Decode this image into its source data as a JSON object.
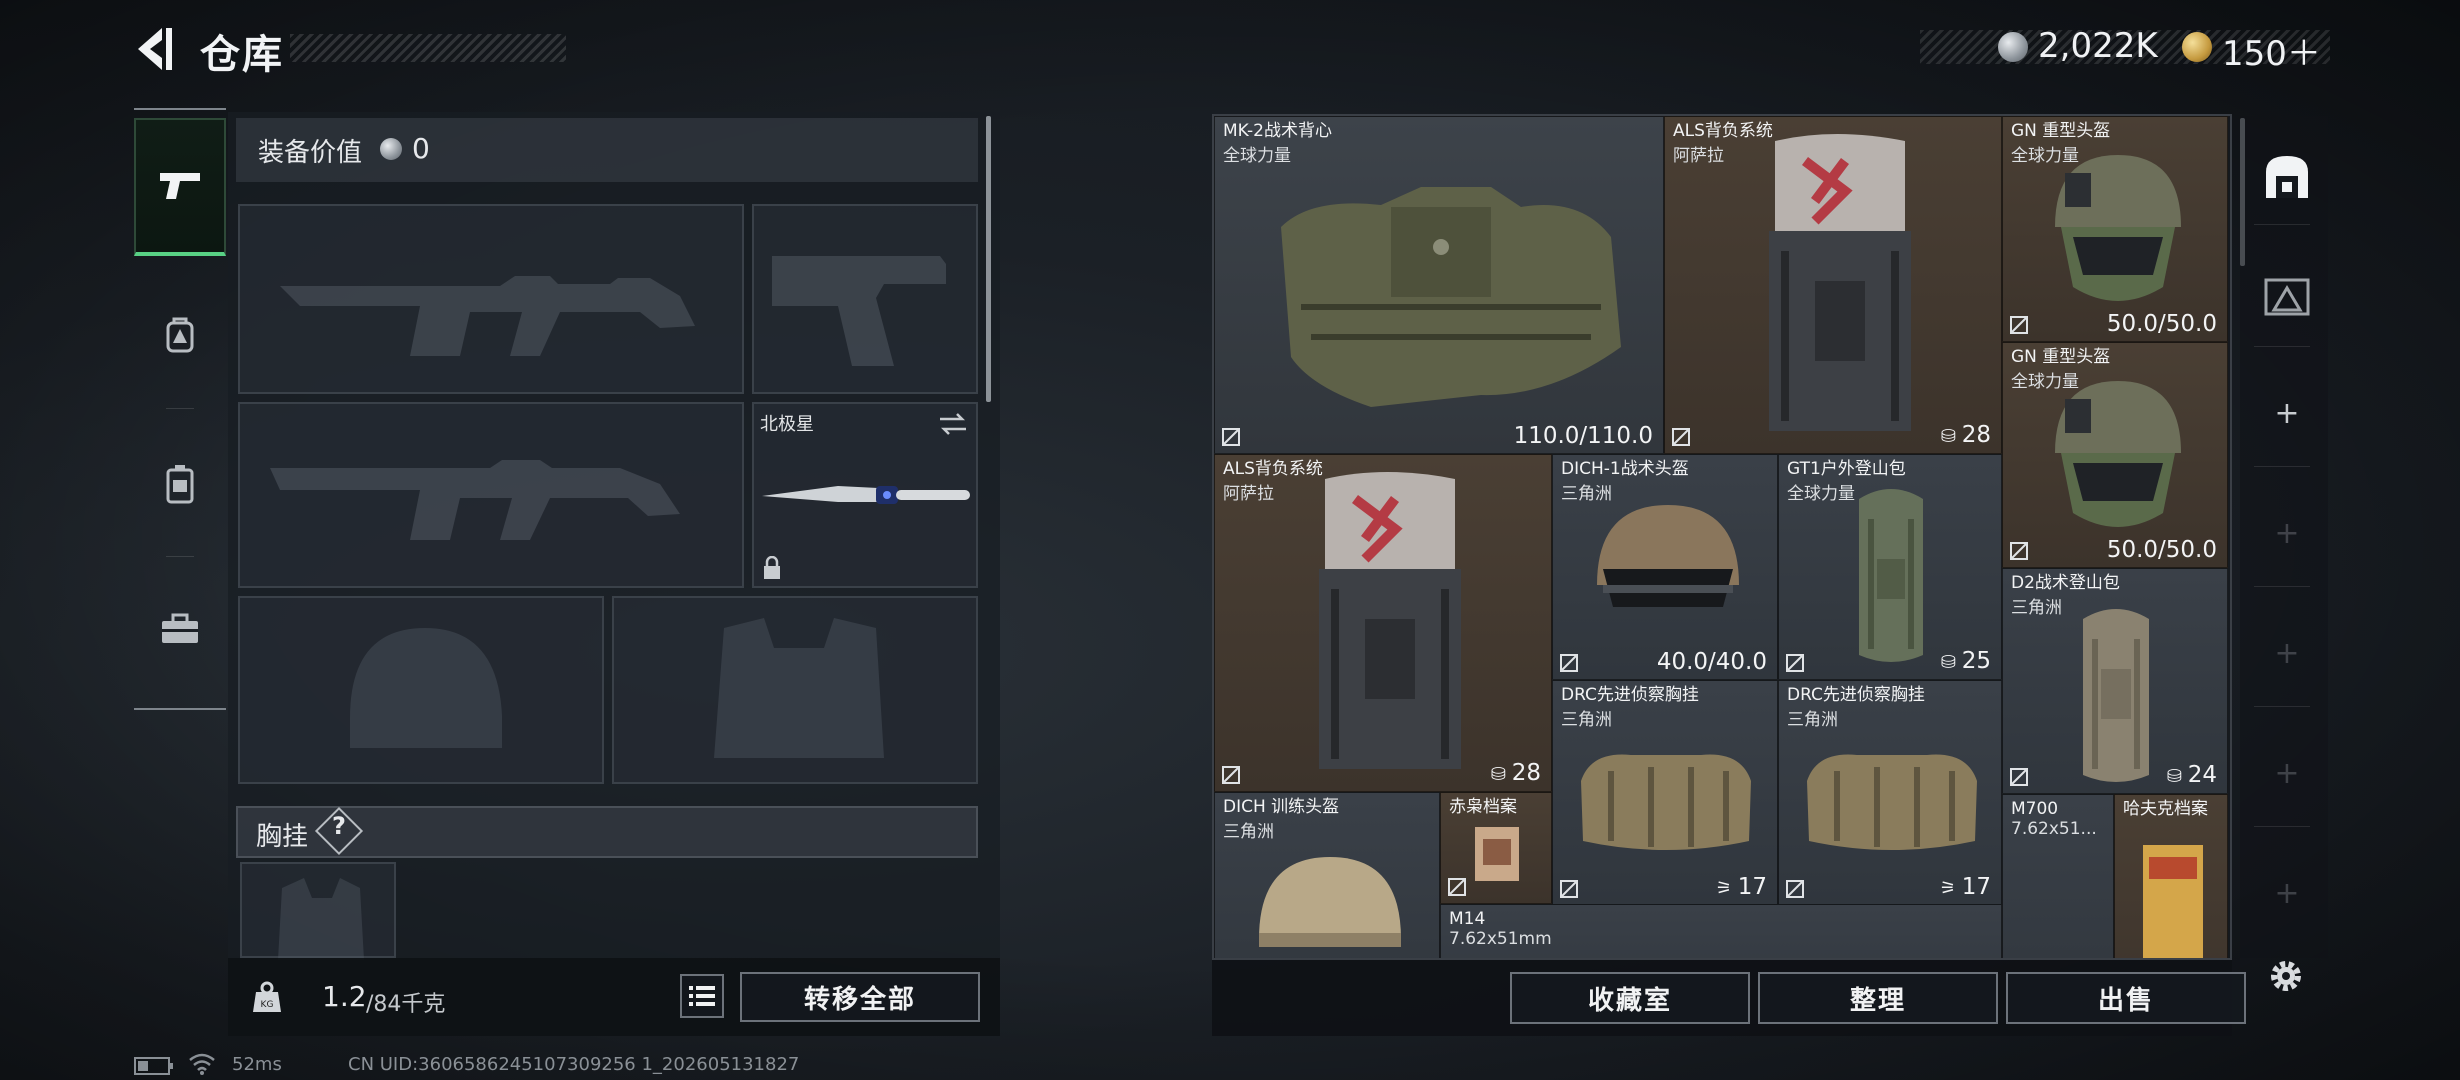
{
  "header": {
    "title": "仓库",
    "currency_silver": "2,022K",
    "currency_gold": "150＋"
  },
  "left_nav": {
    "items": [
      {
        "name": "weapons",
        "icon": "pistol-icon",
        "active": true
      },
      {
        "name": "helmet-armor",
        "icon": "backpack-icon",
        "active": false
      },
      {
        "name": "backpack",
        "icon": "bag-icon",
        "active": false
      },
      {
        "name": "toolbox",
        "icon": "toolbox-icon",
        "active": false
      }
    ]
  },
  "equipment": {
    "value_label": "装备价值",
    "value": "0",
    "melee_label": "北极星",
    "chest_rig_label": "胸挂",
    "help": "?"
  },
  "bottom_left": {
    "weight_current": "1.2",
    "weight_max": "/84千克",
    "transfer_all": "转移全部"
  },
  "items": [
    {
      "name": "MK-2战术背心",
      "sub": "全球力量",
      "value": "110.0/110.0",
      "bg": "dark"
    },
    {
      "name": "ALS背负系统",
      "sub": "阿萨拉",
      "value": "28",
      "bg": "brown"
    },
    {
      "name": "GN 重型头盔",
      "sub": "全球力量",
      "value": "50.0/50.0",
      "bg": "brown"
    },
    {
      "name": "GN 重型头盔",
      "sub": "全球力量",
      "value": "50.0/50.0",
      "bg": "brown"
    },
    {
      "name": "ALS背负系统",
      "sub": "阿萨拉",
      "value": "28",
      "bg": "brown"
    },
    {
      "name": "DICH-1战术头盔",
      "sub": "三角洲",
      "value": "40.0/40.0",
      "bg": "dark"
    },
    {
      "name": "GT1户外登山包",
      "sub": "全球力量",
      "value": "25",
      "bg": "dark"
    },
    {
      "name": "D2战术登山包",
      "sub": "三角洲",
      "value": "24",
      "bg": "dark"
    },
    {
      "name": "DRC先进侦察胸挂",
      "sub": "三角洲",
      "value": "17",
      "bg": "dark"
    },
    {
      "name": "DRC先进侦察胸挂",
      "sub": "三角洲",
      "value": "17",
      "bg": "dark"
    },
    {
      "name": "DICH 训练头盔",
      "sub": "三角洲",
      "value": "",
      "bg": "dark"
    },
    {
      "name": "赤枭档案",
      "sub": "",
      "value": "",
      "bg": "brown"
    },
    {
      "name": "M14",
      "sub": "7.62x51mm",
      "value": "",
      "bg": "dark"
    },
    {
      "name": "M700",
      "sub": "7.62x51...",
      "value": "",
      "bg": "dark"
    },
    {
      "name": "哈夫克档案",
      "sub": "",
      "value": "",
      "bg": "brown"
    }
  ],
  "bottom_right": {
    "collection": "收藏室",
    "organize": "整理",
    "sell": "出售"
  },
  "status": {
    "ping": "52ms",
    "uid": "CN UID:3606586245107309256 1_202605131827"
  }
}
